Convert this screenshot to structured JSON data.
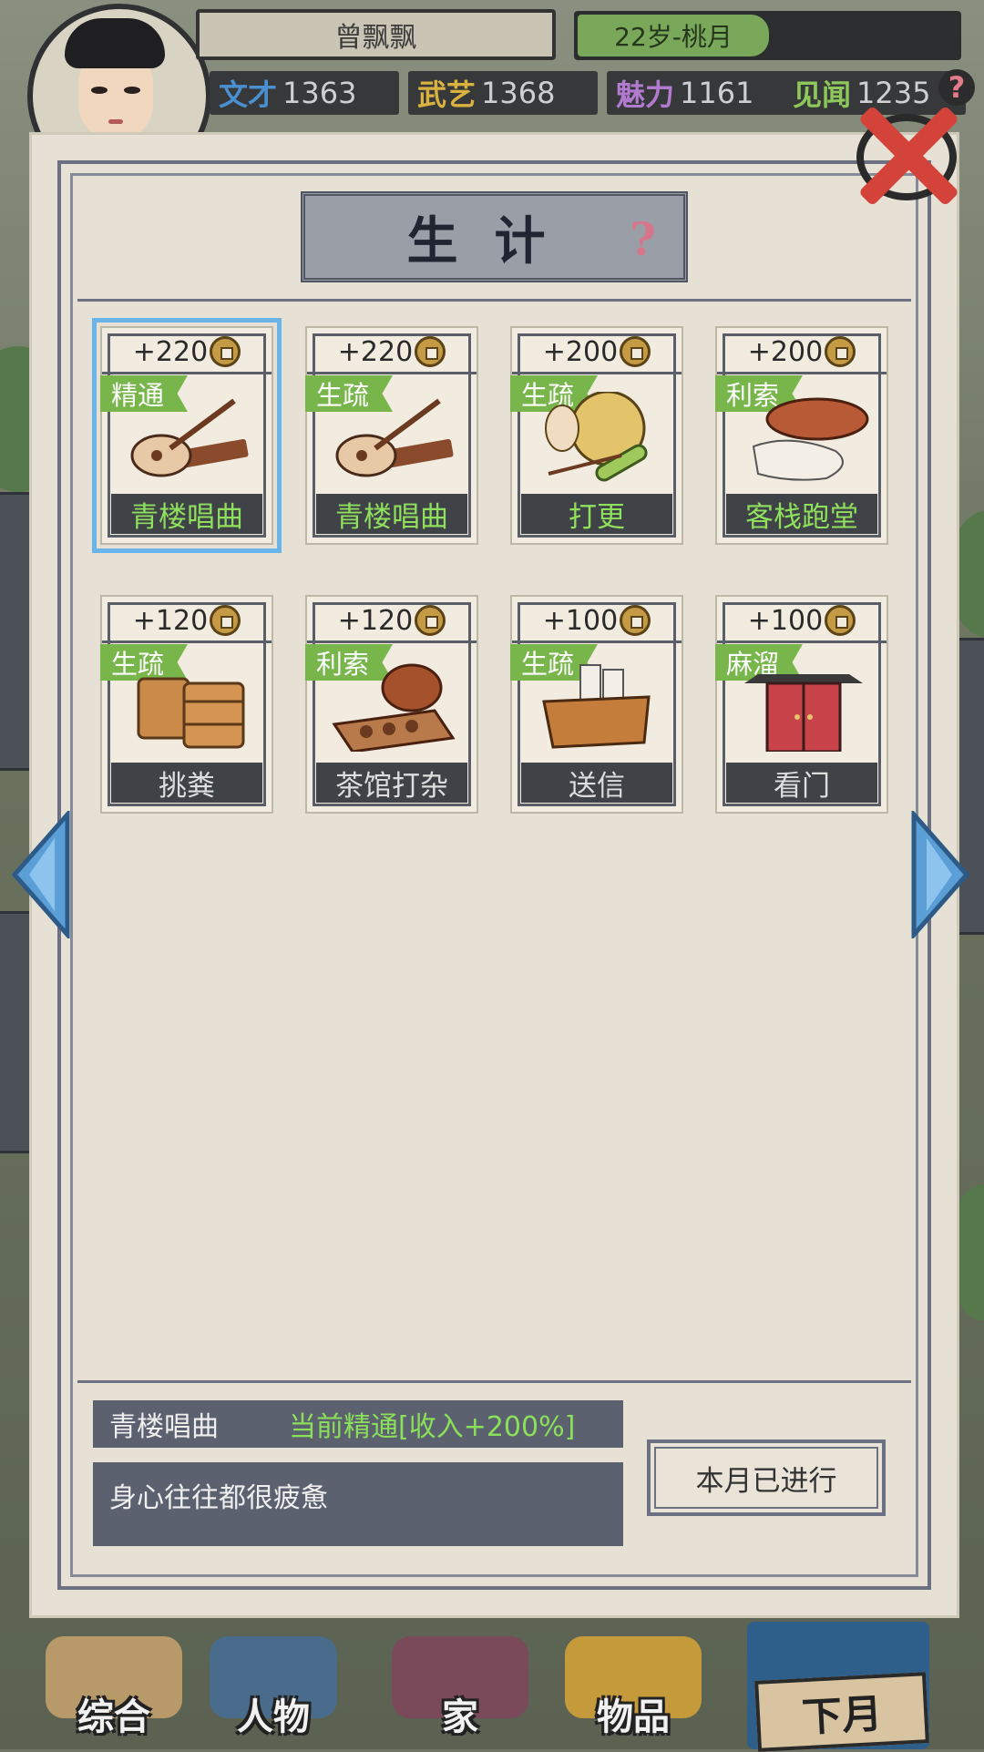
{
  "player": {
    "name": "曾飘飘",
    "age_month": "22岁-桃月",
    "stats": [
      {
        "key": "文才",
        "value": "1363",
        "color": "#4a8fd0"
      },
      {
        "key": "武艺",
        "value": "1368",
        "color": "#d9b23f"
      },
      {
        "key": "魅力",
        "value": "1161",
        "color": "#b27ad0"
      },
      {
        "key": "见闻",
        "value": "1235",
        "color": "#8fc85a"
      }
    ],
    "stat_help": "?"
  },
  "panel": {
    "title": "生计",
    "help": "?"
  },
  "jobs": [
    {
      "income": "+220",
      "level": "精通",
      "label": "青楼唱曲",
      "icon": "pipa-guzheng-icon",
      "selected": true
    },
    {
      "income": "+220",
      "level": "生疏",
      "label": "青楼唱曲",
      "icon": "pipa-guzheng-icon",
      "selected": false
    },
    {
      "income": "+200",
      "level": "生疏",
      "label": "打更",
      "icon": "gong-bamboo-icon",
      "selected": false
    },
    {
      "income": "+200",
      "level": "利索",
      "label": "客栈跑堂",
      "icon": "cloth-cap-icon",
      "selected": false
    },
    {
      "income": "+120",
      "level": "生疏",
      "label": "挑粪",
      "icon": "wooden-buckets-icon",
      "selected": false
    },
    {
      "income": "+120",
      "level": "利索",
      "label": "茶馆打杂",
      "icon": "teapot-tray-icon",
      "selected": false
    },
    {
      "income": "+100",
      "level": "生疏",
      "label": "送信",
      "icon": "letter-bag-icon",
      "selected": false
    },
    {
      "income": "+100",
      "level": "麻溜",
      "label": "看门",
      "icon": "red-door-icon",
      "selected": false
    }
  ],
  "selected_info": {
    "name": "青楼唱曲",
    "level_text": "当前精通[收入+200%]",
    "description": "身心往往都很疲惫"
  },
  "action_button": "本月已进行",
  "bottom_nav": [
    {
      "label": "综合"
    },
    {
      "label": "人物"
    },
    {
      "label": "家"
    },
    {
      "label": "物品"
    },
    {
      "label": "下月"
    }
  ],
  "colors": {
    "selected_outline": "#6ab4ea",
    "level_tag": "#78b64c",
    "active_label": "#8fe05c",
    "close_x": "#d4433a",
    "arrow": "#5b9fd6"
  }
}
